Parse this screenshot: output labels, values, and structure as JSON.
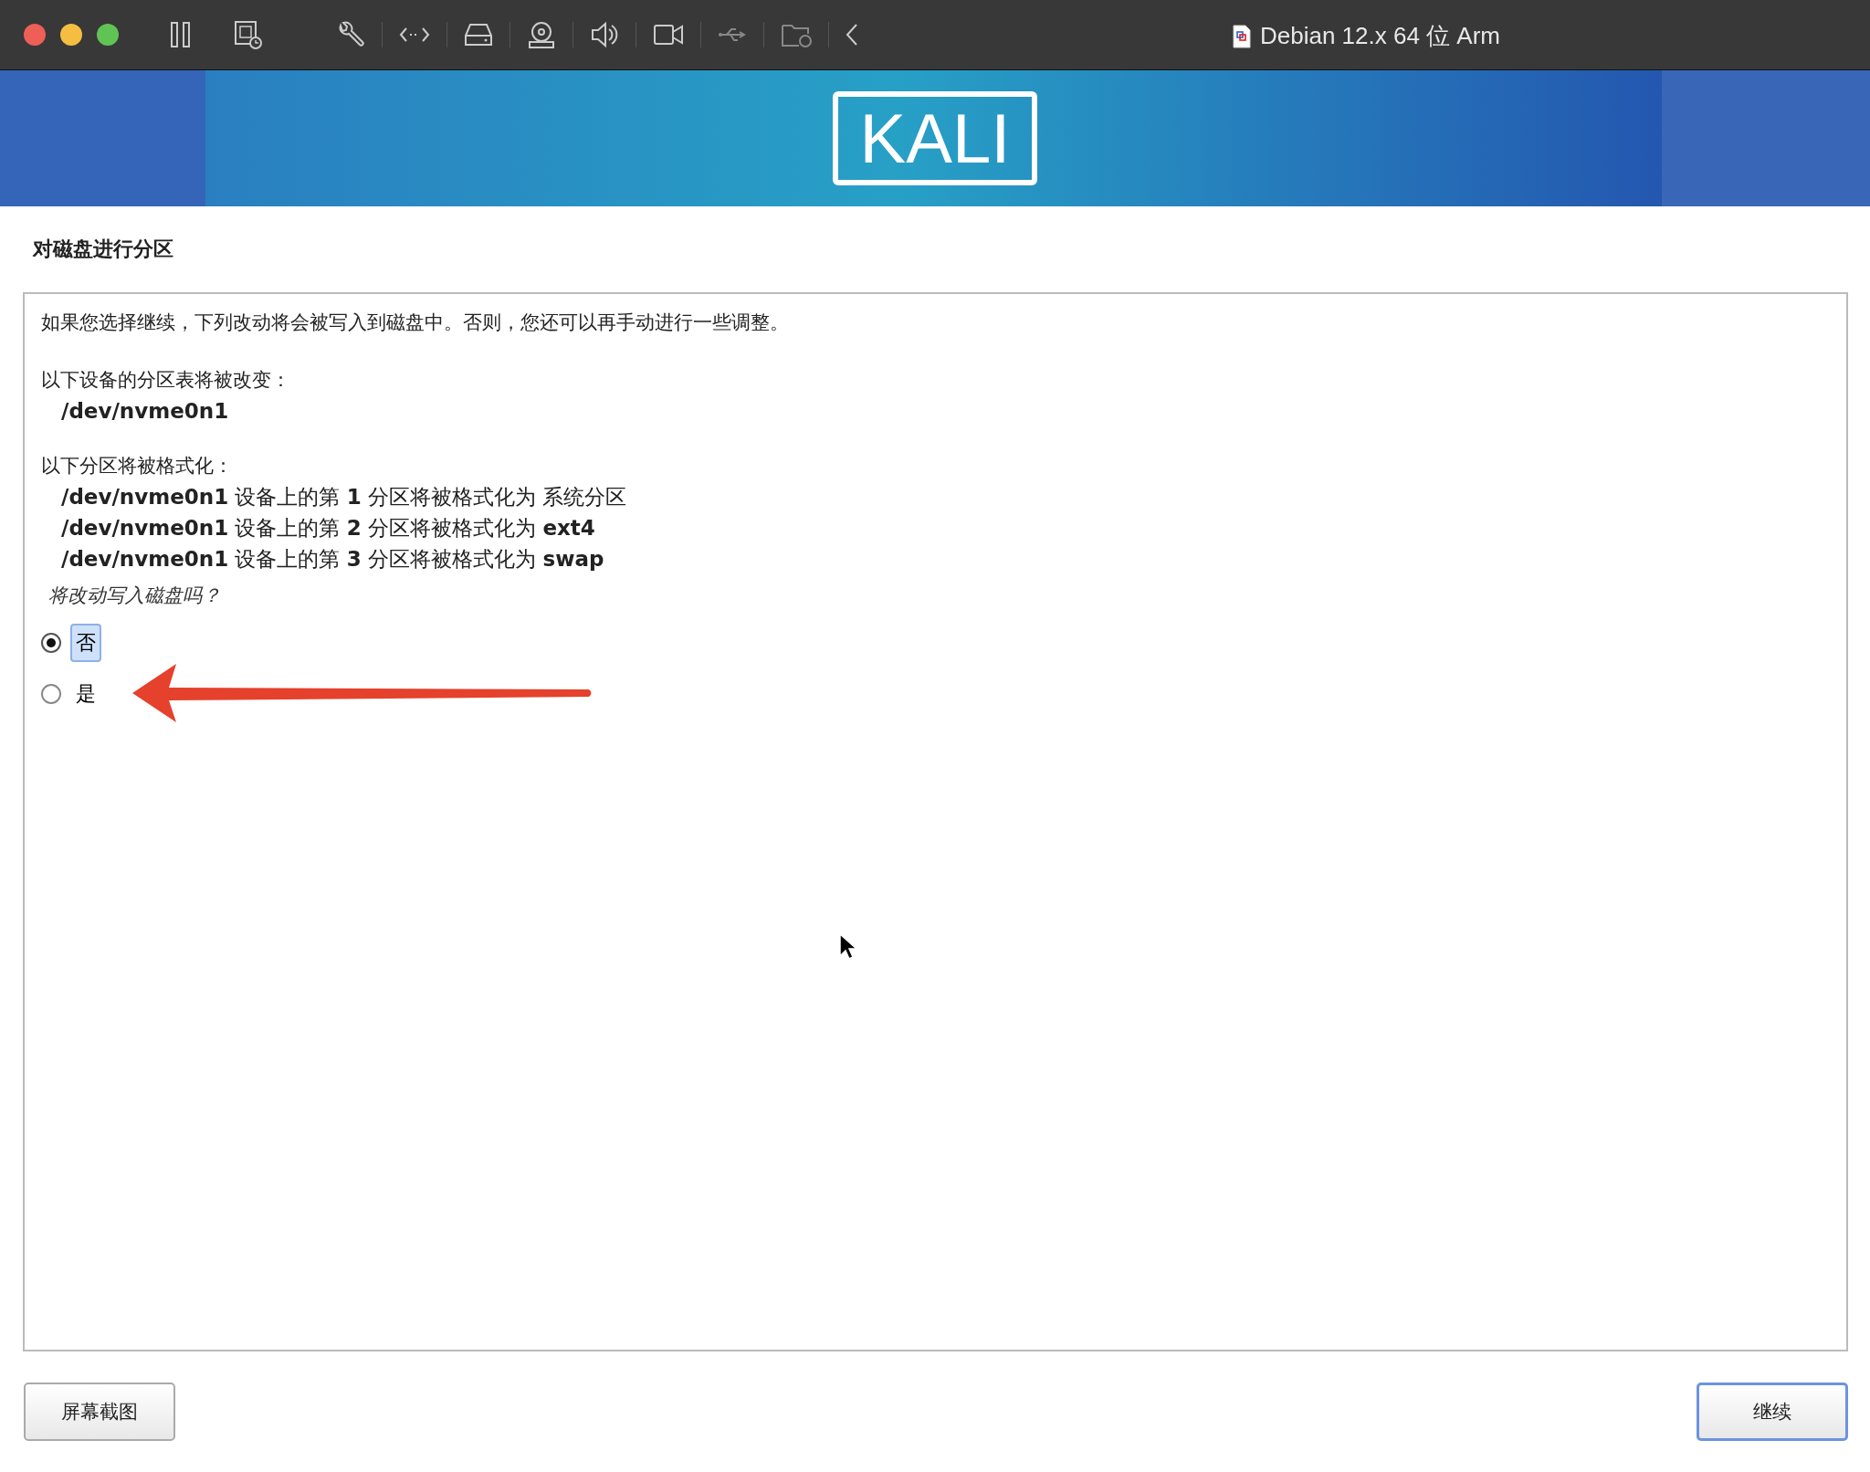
{
  "window": {
    "title": "Debian 12.x 64 位 Arm"
  },
  "banner": {
    "logo": "KALI"
  },
  "heading": "对磁盘进行分区",
  "intro": "如果您选择继续，下列改动将会被写入到磁盘中。否则，您还可以再手动进行一些调整。",
  "table_change": {
    "label": "以下设备的分区表将被改变：",
    "devices": [
      "/dev/nvme0n1"
    ]
  },
  "format": {
    "label": "以下分区将被格式化：",
    "lines": [
      "**/dev/nvme0n1** 设备上的第 **1** 分区将被格式化为 系统分区",
      "**/dev/nvme0n1** 设备上的第 **2** 分区将被格式化为 **ext4**",
      "**/dev/nvme0n1** 设备上的第 **3** 分区将被格式化为 **swap**"
    ]
  },
  "question": "将改动写入磁盘吗？",
  "options": [
    {
      "label": "否",
      "selected": true
    },
    {
      "label": "是",
      "selected": false
    }
  ],
  "buttons": [
    {
      "label": "屏幕截图",
      "kind": "normal"
    },
    {
      "label": "继续",
      "kind": "default"
    }
  ]
}
